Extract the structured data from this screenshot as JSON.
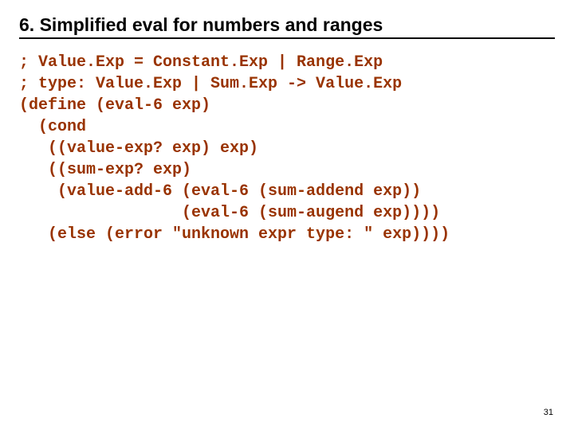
{
  "title": "6. Simplified eval for numbers and ranges",
  "code": {
    "l1": "; Value.Exp = Constant.Exp | Range.Exp",
    "l2": "; type: Value.Exp | Sum.Exp -> Value.Exp",
    "l3": "(define (eval-6 exp)",
    "l4": "  (cond",
    "l5": "   ((value-exp? exp) exp)",
    "l6": "   ((sum-exp? exp)",
    "l7": "    (value-add-6 (eval-6 (sum-addend exp))",
    "l8": "                 (eval-6 (sum-augend exp))))",
    "l9": "   (else (error \"unknown expr type: \" exp))))"
  },
  "page_number": "31"
}
